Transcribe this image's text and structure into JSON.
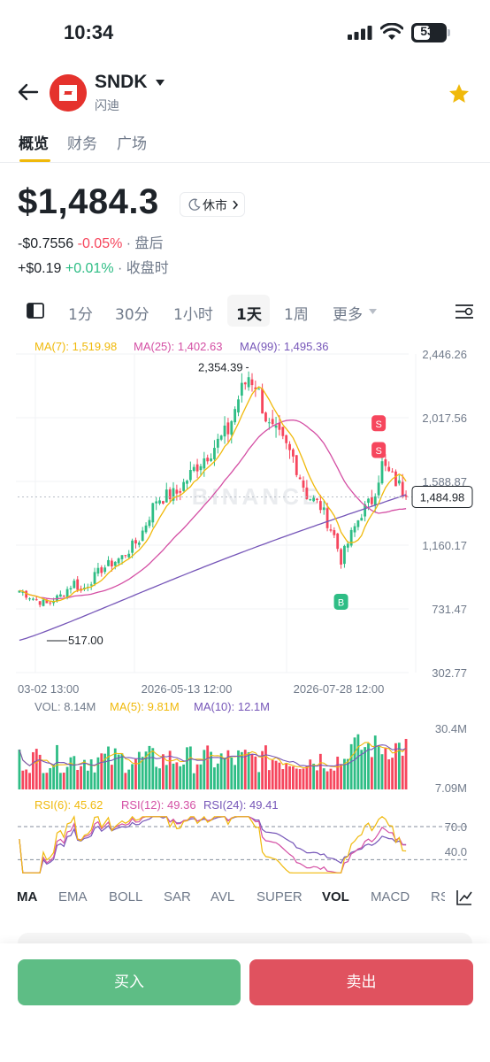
{
  "status_bar": {
    "time": "10:34",
    "battery": "53",
    "battery_level": 0.53
  },
  "header": {
    "ticker": "SNDK",
    "company": "闪迪",
    "back_icon": "arrow-left-icon",
    "favorite_icon": "star-icon",
    "favorite_color": "#f0b90b",
    "logo_color": "#e5322d"
  },
  "tabs": [
    {
      "label": "概览",
      "active": true
    },
    {
      "label": "财务",
      "active": false
    },
    {
      "label": "广场",
      "active": false
    }
  ],
  "quote": {
    "price": "$1,484.3",
    "market_status": "休市",
    "after_hours": {
      "change": "-$0.7556",
      "percent": "-0.05%",
      "label": "· 盘后"
    },
    "at_close": {
      "change": "+$0.19",
      "percent": "+0.01%",
      "label": "· 收盘时"
    }
  },
  "intervals": [
    {
      "label": "1分",
      "active": false
    },
    {
      "label": "30分",
      "active": false
    },
    {
      "label": "1小时",
      "active": false
    },
    {
      "label": "1天",
      "active": true
    },
    {
      "label": "1周",
      "active": false
    },
    {
      "label": "更多",
      "active": false
    }
  ],
  "colors": {
    "up": "#2ebd85",
    "down": "#f6465d",
    "ma7": "#f0b90b",
    "ma25": "#d44fa4",
    "ma99": "#7656b8",
    "grid": "#f2f3f5"
  },
  "chart_data": [
    {
      "type": "candlestick",
      "title": "",
      "legend": [
        {
          "name": "MA(7)",
          "value": "1,519.98"
        },
        {
          "name": "MA(25)",
          "value": "1,402.63"
        },
        {
          "name": "MA(99)",
          "value": "1,495.36"
        }
      ],
      "y_ticks": [
        "2,446.26",
        "2,017.56",
        "1,588.87",
        "1,160.17",
        "731.47",
        "302.77"
      ],
      "ylim": [
        302.77,
        2446.26
      ],
      "x_ticks": [
        "03-02 13:00",
        "2026-05-13 12:00",
        "2026-07-28 12:00"
      ],
      "annotations": {
        "high": "2,354.39",
        "low": "517.00",
        "current": "1,484.98"
      },
      "signals": [
        {
          "type": "B"
        },
        {
          "type": "S"
        },
        {
          "type": "S"
        }
      ],
      "grid": true,
      "watermark": "BINANCE",
      "anchors": [
        [
          0,
          855
        ],
        [
          5,
          790
        ],
        [
          8,
          765
        ],
        [
          12,
          820
        ],
        [
          16,
          910
        ],
        [
          18,
          850
        ],
        [
          24,
          1000
        ],
        [
          30,
          1080
        ],
        [
          35,
          1200
        ],
        [
          40,
          1470
        ],
        [
          46,
          1510
        ],
        [
          52,
          1700
        ],
        [
          56,
          1800
        ],
        [
          61,
          1930
        ],
        [
          64,
          2150
        ],
        [
          67,
          2300
        ],
        [
          69,
          2250
        ],
        [
          73,
          1950
        ],
        [
          76,
          1880
        ],
        [
          80,
          1750
        ],
        [
          84,
          1500
        ],
        [
          88,
          1420
        ],
        [
          92,
          1220
        ],
        [
          94,
          1060
        ],
        [
          97,
          1230
        ],
        [
          100,
          1380
        ],
        [
          103,
          1460
        ],
        [
          106,
          1700
        ],
        [
          108,
          1640
        ],
        [
          111,
          1560
        ],
        [
          113,
          1485
        ]
      ]
    },
    {
      "type": "bar",
      "title": "",
      "legend": [
        {
          "name": "VOL",
          "value": "8.14M"
        },
        {
          "name": "MA(5)",
          "value": "9.81M"
        },
        {
          "name": "MA(10)",
          "value": "12.1M"
        }
      ],
      "y_ticks": [
        "30.4M",
        "7.09M"
      ],
      "ylim": [
        0,
        36
      ]
    },
    {
      "type": "line",
      "title": "",
      "legend": [
        {
          "name": "RSI(6)",
          "value": "45.62"
        },
        {
          "name": "RSI(12)",
          "value": "49.36"
        },
        {
          "name": "RSI(24)",
          "value": "49.41"
        }
      ],
      "y_ticks": [
        "70.0",
        "40.0"
      ],
      "ylim": [
        10,
        85
      ],
      "reference_lines": [
        70,
        30
      ]
    }
  ],
  "indicator_tabs": [
    {
      "label": "MA",
      "active": true
    },
    {
      "label": "EMA",
      "active": false
    },
    {
      "label": "BOLL",
      "active": false
    },
    {
      "label": "SAR",
      "active": false
    },
    {
      "label": "AVL",
      "active": false
    },
    {
      "label": "SUPER",
      "active": false
    },
    {
      "label": "VOL",
      "active": true
    },
    {
      "label": "MACD",
      "active": false
    },
    {
      "label": "RSI",
      "active": false
    }
  ],
  "actions": {
    "buy": "买入",
    "sell": "卖出",
    "buy_color": "#5ebd85",
    "sell_color": "#e0525f"
  }
}
